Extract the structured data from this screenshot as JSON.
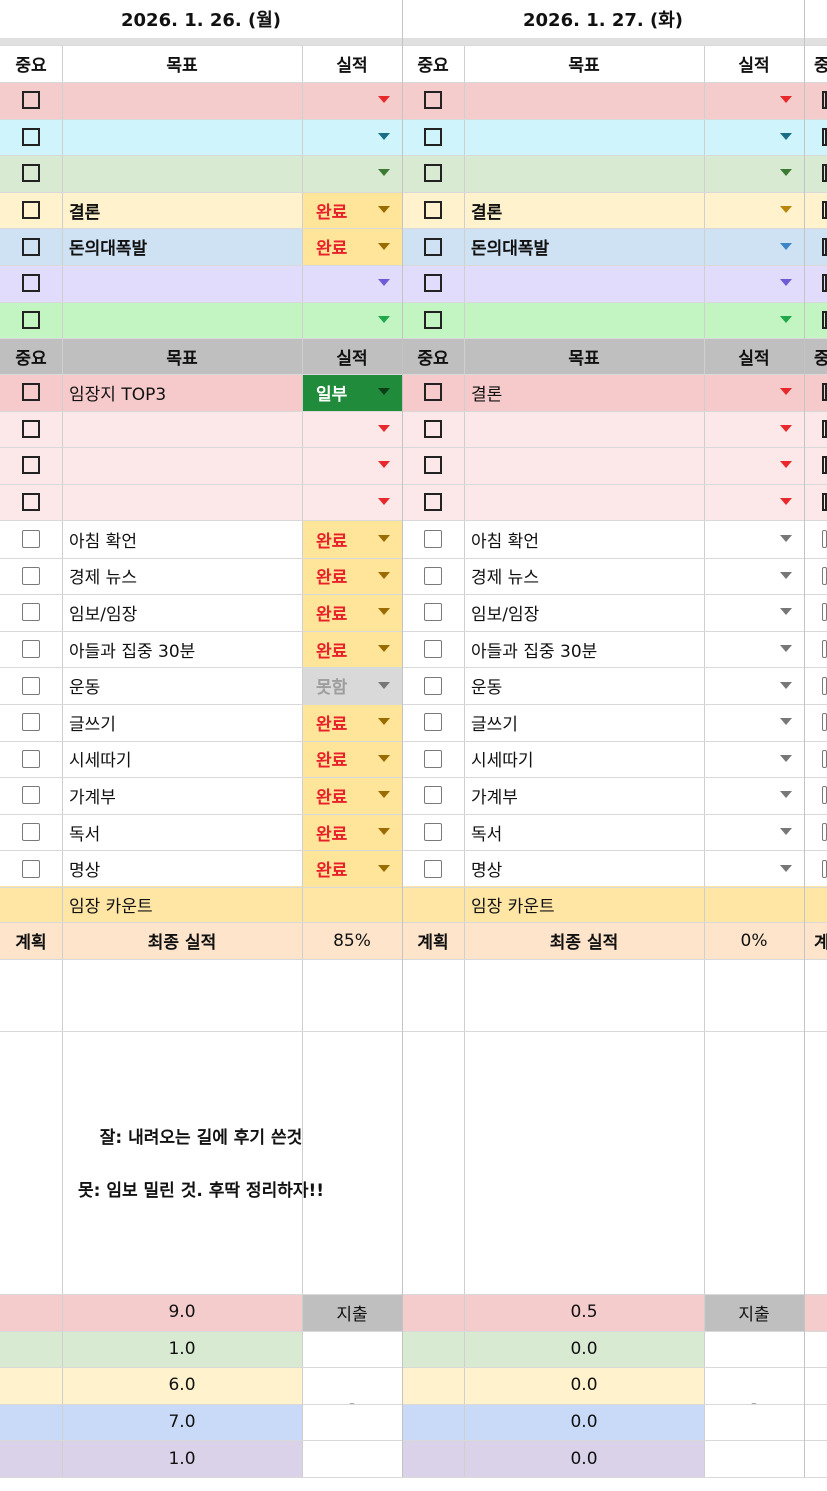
{
  "days": [
    {
      "date": "2026. 1. 26. (월)",
      "priority_rows": [
        {
          "goal": "",
          "result": ""
        },
        {
          "goal": "",
          "result": ""
        },
        {
          "goal": "",
          "result": ""
        },
        {
          "goal": "결론",
          "result": "완료"
        },
        {
          "goal": "돈의대폭발",
          "result": "완료"
        },
        {
          "goal": "",
          "result": ""
        },
        {
          "goal": "",
          "result": ""
        }
      ],
      "task_rows": [
        {
          "goal": "임장지 TOP3",
          "result": "일부"
        },
        {
          "goal": "",
          "result": ""
        },
        {
          "goal": "",
          "result": ""
        },
        {
          "goal": "",
          "result": ""
        }
      ],
      "habit_rows": [
        {
          "goal": "아침 확언",
          "result": "완료"
        },
        {
          "goal": "경제 뉴스",
          "result": "완료"
        },
        {
          "goal": "임보/임장",
          "result": "완료"
        },
        {
          "goal": "아들과 집중 30분",
          "result": "완료"
        },
        {
          "goal": "운동",
          "result": "못함"
        },
        {
          "goal": "글쓰기",
          "result": "완료"
        },
        {
          "goal": "시세따기",
          "result": "완료"
        },
        {
          "goal": "가계부",
          "result": "완료"
        },
        {
          "goal": "독서",
          "result": "완료"
        },
        {
          "goal": "명상",
          "result": "완료"
        }
      ],
      "count_label": "임장 카운트",
      "summary": {
        "plan": "계획",
        "final_label": "최종 실적",
        "final_value": "85%"
      },
      "memo_good": "잘: 내려오는 길에 후기 쓴것",
      "memo_bad": "못: 임보 밀린 것. 후딱 정리하자!!",
      "numbers": [
        "9.0",
        "1.0",
        "6.0",
        "7.0",
        "1.0"
      ],
      "expense_label": "지출",
      "expense_value": "-"
    },
    {
      "date": "2026. 1. 27. (화)",
      "priority_rows": [
        {
          "goal": "",
          "result": ""
        },
        {
          "goal": "",
          "result": ""
        },
        {
          "goal": "",
          "result": ""
        },
        {
          "goal": "결론",
          "result": ""
        },
        {
          "goal": "돈의대폭발",
          "result": ""
        },
        {
          "goal": "",
          "result": ""
        },
        {
          "goal": "",
          "result": ""
        }
      ],
      "task_rows": [
        {
          "goal": "결론",
          "result": ""
        },
        {
          "goal": "",
          "result": ""
        },
        {
          "goal": "",
          "result": ""
        },
        {
          "goal": "",
          "result": ""
        }
      ],
      "habit_rows": [
        {
          "goal": "아침 확언",
          "result": ""
        },
        {
          "goal": "경제 뉴스",
          "result": ""
        },
        {
          "goal": "임보/임장",
          "result": ""
        },
        {
          "goal": "아들과 집중 30분",
          "result": ""
        },
        {
          "goal": "운동",
          "result": ""
        },
        {
          "goal": "글쓰기",
          "result": ""
        },
        {
          "goal": "시세따기",
          "result": ""
        },
        {
          "goal": "가계부",
          "result": ""
        },
        {
          "goal": "독서",
          "result": ""
        },
        {
          "goal": "명상",
          "result": ""
        }
      ],
      "count_label": "임장 카운트",
      "summary": {
        "plan": "계획",
        "final_label": "최종 실적",
        "final_value": "0%"
      },
      "memo_good": "",
      "memo_bad": "",
      "numbers": [
        "0.5",
        "0.0",
        "0.0",
        "0.0",
        "0.0"
      ],
      "expense_label": "지출",
      "expense_value": "-"
    }
  ],
  "headers": {
    "importance": "중요",
    "goal": "목표",
    "result": "실적"
  },
  "partial_next_column": {
    "header_text": "중",
    "plan_text": "계"
  },
  "colors": {
    "priority_rows": [
      "#f4cccc",
      "#d0f4fb",
      "#d9ead3",
      "#fff2cc",
      "#cfe2f3",
      "#e2dcfc",
      "#c3f5c3"
    ],
    "priority_arrows": [
      "#e8282b",
      "#1a6d86",
      "#3b7a33",
      "#b8860b",
      "#3d85c6",
      "#6f5bd6",
      "#21a84a"
    ],
    "task_rows": "#fce8e8",
    "task_first": "#f6cacb",
    "header_gray": "#bfbfbf",
    "done_bg": "#ffe599",
    "done_text": "#e8202a",
    "partial_bg": "#1f8b3b",
    "fail_bg": "#d9d9d9",
    "fail_text": "#9e9e9e",
    "count_bg": "#ffe6a4",
    "summary_bg": "#fde4cb",
    "number_rows": [
      "#f4cccc",
      "#d9ead3",
      "#fff2cc",
      "#c9daf8",
      "#d9d2e9"
    ]
  },
  "icons": {
    "dropdown": "dropdown-arrow-icon",
    "checkbox": "checkbox-icon"
  }
}
